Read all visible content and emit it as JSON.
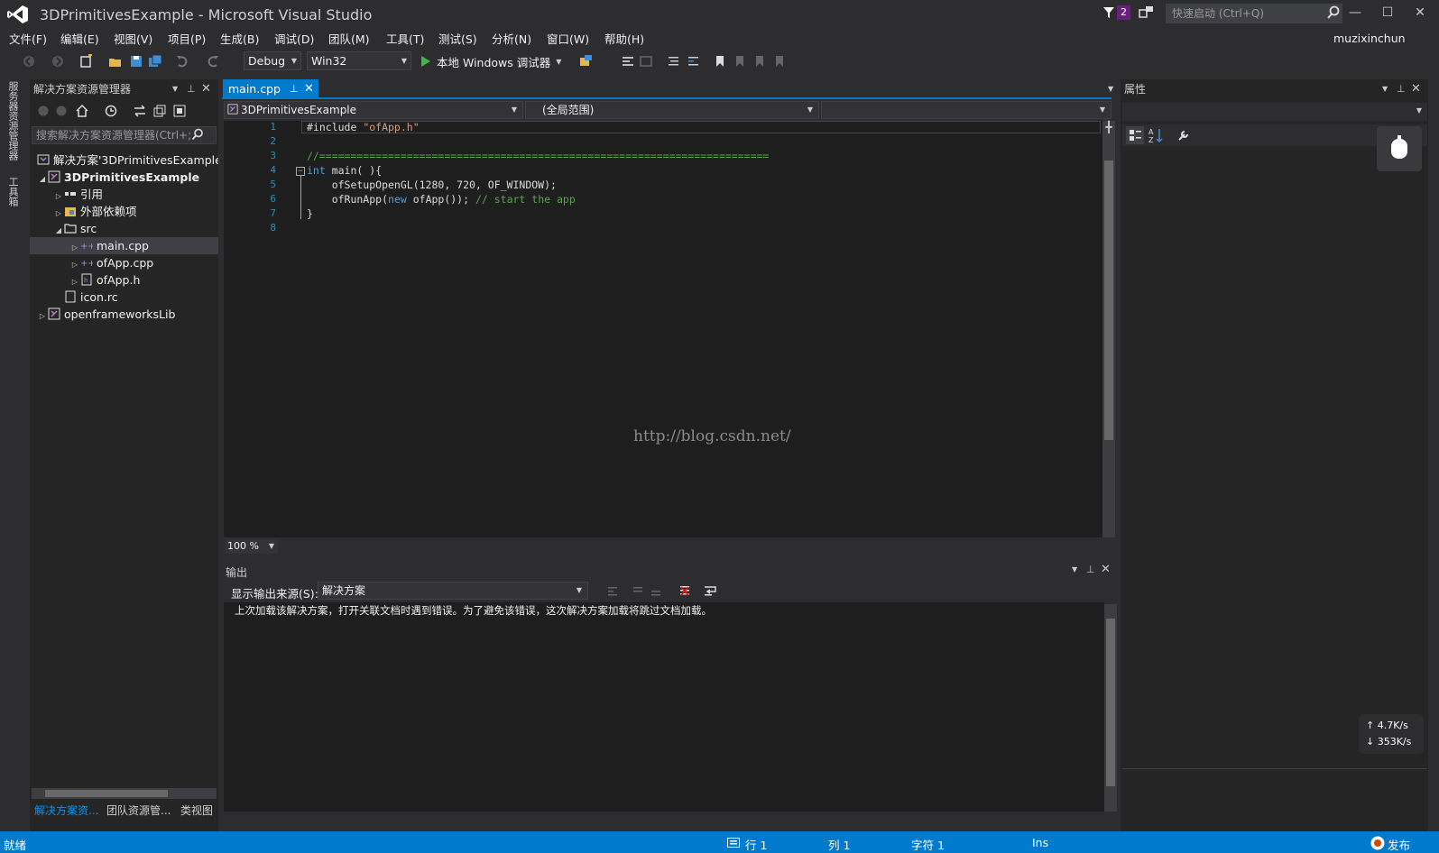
{
  "window": {
    "title": "3DPrimitivesExample - Microsoft Visual Studio",
    "notification_count": "2",
    "quick_launch_placeholder": "快速启动 (Ctrl+Q)",
    "user": "muzixinchun",
    "minimize": "—",
    "maximize": "☐",
    "close": "✕"
  },
  "menu": [
    "文件(F)",
    "编辑(E)",
    "视图(V)",
    "项目(P)",
    "生成(B)",
    "调试(D)",
    "团队(M)",
    "工具(T)",
    "测试(S)",
    "分析(N)",
    "窗口(W)",
    "帮助(H)"
  ],
  "toolbar": {
    "configuration": "Debug",
    "platform": "Win32",
    "run_label": "本地 Windows 调试器"
  },
  "left_strip": {
    "tabs": [
      "服务器资源管理器",
      "工具箱"
    ]
  },
  "solution_explorer": {
    "title": "解决方案资源管理器",
    "search_placeholder": "搜索解决方案资源管理器(Ctrl+;",
    "tree": [
      {
        "label": "解决方案'3DPrimitivesExample'",
        "level": 0,
        "arrow": "",
        "icon": "solution-icon",
        "bold": false
      },
      {
        "label": "3DPrimitivesExample",
        "level": 0,
        "arrow": "◢",
        "icon": "project-icon",
        "bold": true
      },
      {
        "label": "引用",
        "level": 1,
        "arrow": "▷",
        "icon": "references-icon",
        "bold": false
      },
      {
        "label": "外部依赖项",
        "level": 1,
        "arrow": "▷",
        "icon": "external-deps-icon",
        "bold": false
      },
      {
        "label": "src",
        "level": 1,
        "arrow": "◢",
        "icon": "folder-icon",
        "bold": false
      },
      {
        "label": "main.cpp",
        "level": 2,
        "arrow": "▷",
        "icon": "cpp-file-icon",
        "bold": false,
        "selected": true
      },
      {
        "label": "ofApp.cpp",
        "level": 2,
        "arrow": "▷",
        "icon": "cpp-file-icon",
        "bold": false
      },
      {
        "label": "ofApp.h",
        "level": 2,
        "arrow": "▷",
        "icon": "header-file-icon",
        "bold": false
      },
      {
        "label": "icon.rc",
        "level": 1,
        "arrow": "",
        "icon": "resource-file-icon",
        "bold": false
      },
      {
        "label": "openframeworksLib",
        "level": 0,
        "arrow": "▷",
        "icon": "project-icon",
        "bold": false
      }
    ],
    "bottom_tabs": [
      "解决方案资...",
      "团队资源管...",
      "类视图"
    ]
  },
  "editor": {
    "tab": "main.cpp",
    "nav_project": "3DPrimitivesExample",
    "nav_scope": "(全局范围)",
    "zoom": "100 %",
    "line_numbers": [
      "1",
      "2",
      "3",
      "4",
      "5",
      "6",
      "7",
      "8"
    ],
    "lines": {
      "l1_kw": "#include ",
      "l1_str": "\"ofApp.h\"",
      "l3_cm": "//========================================================================",
      "l4_kw": "int",
      "l4_rest": " main( ){",
      "l5": "    ofSetupOpenGL(1280, 720, OF_WINDOW);",
      "l6_a": "    ofRunApp(",
      "l6_kw": "new",
      "l6_b": " ofApp()); ",
      "l6_cm": "// start the app",
      "l7": "}"
    },
    "fold": "−",
    "watermark": "http://blog.csdn.net/"
  },
  "output": {
    "title": "输出",
    "source_label": "显示输出来源(S):",
    "source_value": "解决方案",
    "message": "上次加载该解决方案，打开关联文档时遇到错误。为了避免该错误，这次解决方案加载将跳过文档加载。"
  },
  "properties": {
    "title": "属性"
  },
  "net_widget": {
    "up": "↑ 4.7K/s",
    "down": "↓ 353K/s"
  },
  "status": {
    "ready": "就绪",
    "line": "行 1",
    "col": "列 1",
    "char": "字符 1",
    "mode": "Ins",
    "publish": "发布"
  },
  "colors": {
    "accent": "#007acc",
    "background": "#2d2d30",
    "editor": "#1e1e1e"
  }
}
